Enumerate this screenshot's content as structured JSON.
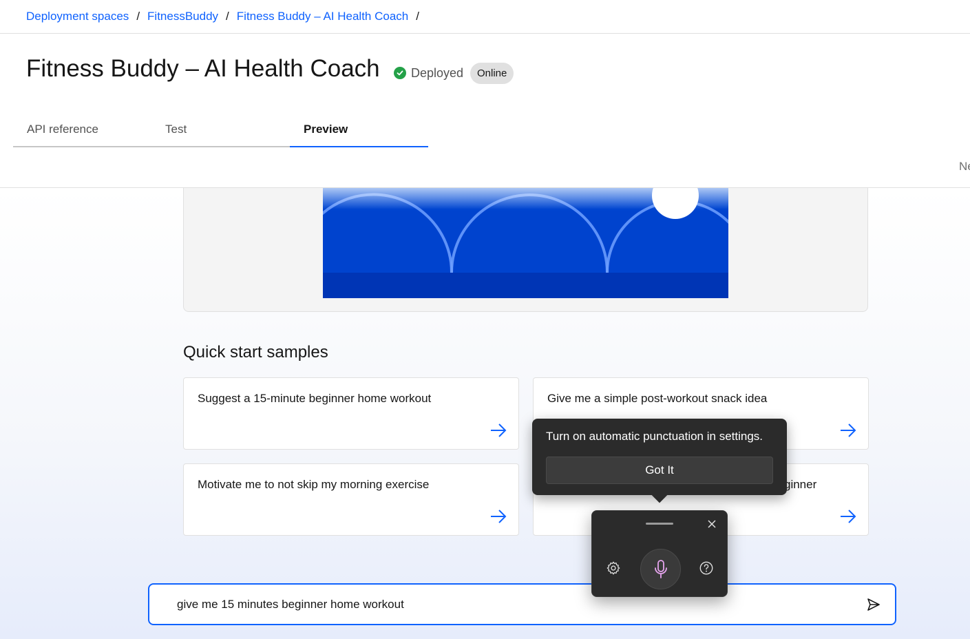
{
  "breadcrumb": {
    "items": [
      "Deployment spaces",
      "FitnessBuddy",
      "Fitness Buddy – AI Health Coach"
    ],
    "separator": "/"
  },
  "header": {
    "title": "Fitness Buddy – AI Health Coach",
    "status": "Deployed",
    "badge": "Online"
  },
  "tabs": [
    {
      "label": "API reference"
    },
    {
      "label": "Test"
    },
    {
      "label": "Preview"
    }
  ],
  "truncated_right_text": "Ne",
  "quick_start": {
    "title": "Quick start samples",
    "samples": [
      "Suggest a 15-minute beginner home workout",
      "Give me a simple post-workout snack idea",
      "Motivate me to not skip my morning exercise",
      "ginner"
    ]
  },
  "chat_input": {
    "value": "give me 15 minutes beginner home workout"
  },
  "voice_typing": {
    "tip": "Turn on automatic punctuation in settings.",
    "got_it": "Got It"
  },
  "colors": {
    "accent": "#0f62fe",
    "success": "#24a148",
    "hero_blue": "#0043ce",
    "popup_bg": "#2b2b2b",
    "mic_tint": "#e8a6f0"
  },
  "icons": {
    "status": "checkmark-filled-icon",
    "card_arrow": "arrow-right-icon",
    "send": "send-icon",
    "settings": "gear-icon",
    "mic": "microphone-icon",
    "help": "help-icon",
    "close": "close-icon"
  }
}
